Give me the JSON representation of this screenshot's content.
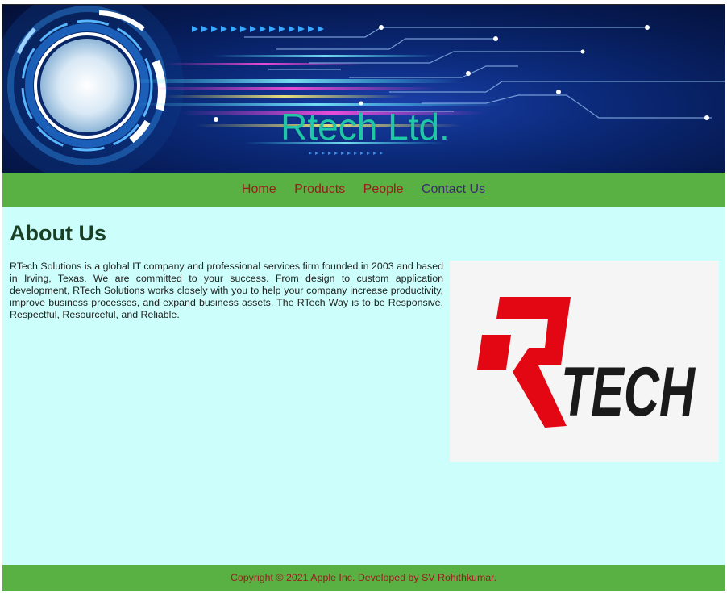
{
  "header": {
    "site_title": "Rtech Ltd."
  },
  "nav": {
    "items": [
      {
        "label": "Home"
      },
      {
        "label": "Products"
      },
      {
        "label": "People"
      },
      {
        "label": "Contact Us"
      }
    ],
    "active_index": 3
  },
  "main": {
    "heading": "About Us",
    "paragraph": "RTech Solutions is a global IT company and professional services firm founded in 2003 and based in Irving, Texas. We are committed to your success. From design to custom application development, RTech Solutions works closely with you to help your company increase productivity, improve business processes, and expand business assets. The RTech Way is to be Responsive, Respectful, Resourceful, and Reliable.",
    "logo_text": "TECH"
  },
  "footer": {
    "copyright": "Copyright © 2021 Apple Inc. Developed by SV Rohithkumar."
  },
  "colors": {
    "nav_bg": "#59b043",
    "content_bg": "#ccfffb",
    "title": "#1fc7a6",
    "nav_link": "#9b1c1c",
    "active_link": "#3d2a6e",
    "heading": "#1a3f27",
    "logo_red": "#e30613",
    "logo_black": "#1a1a1a"
  }
}
